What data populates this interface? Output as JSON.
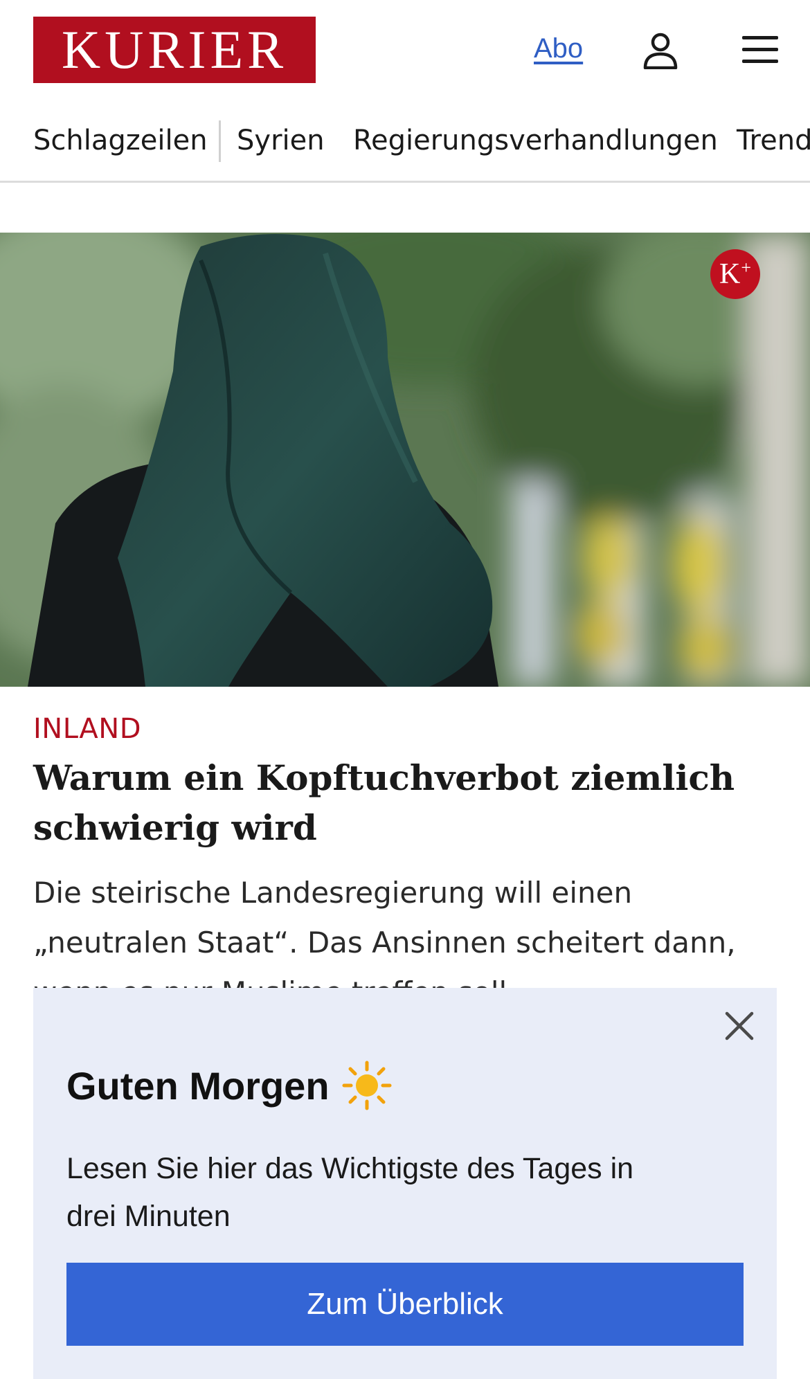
{
  "header": {
    "logo_text": "KURIER",
    "abo_link": "Abo",
    "user_icon": "user-icon",
    "menu_icon": "hamburger-menu-icon"
  },
  "nav": {
    "items": [
      {
        "label": "Schlagzeilen"
      },
      {
        "label": "Syrien"
      },
      {
        "label": "Regierungsverhandlungen"
      },
      {
        "label": "Trend"
      }
    ]
  },
  "hero": {
    "badge": "K",
    "badge_plus": "+",
    "image_subject": "Frau mit Kopftuch von hinten"
  },
  "article": {
    "kicker": "INLAND",
    "headline": "Warum ein Kopftuchverbot ziemlich schwierig wird",
    "teaser": "Die steirische Landesregierung will einen „neutralen Staat“. Das Ansinnen scheitert dann, wenn es nur Muslime treffen soll."
  },
  "popup": {
    "title": "Guten Morgen",
    "title_icon": "sun-icon",
    "text": "Lesen Sie hier das Wichtigste des Tages in drei Minuten",
    "cta_label": "Zum Überblick",
    "close_icon": "close-icon"
  },
  "colors": {
    "brand_red": "#b10f1f",
    "link_blue": "#2f5ec4",
    "popup_bg": "#e9edf8",
    "cta_blue": "#3465d5"
  }
}
